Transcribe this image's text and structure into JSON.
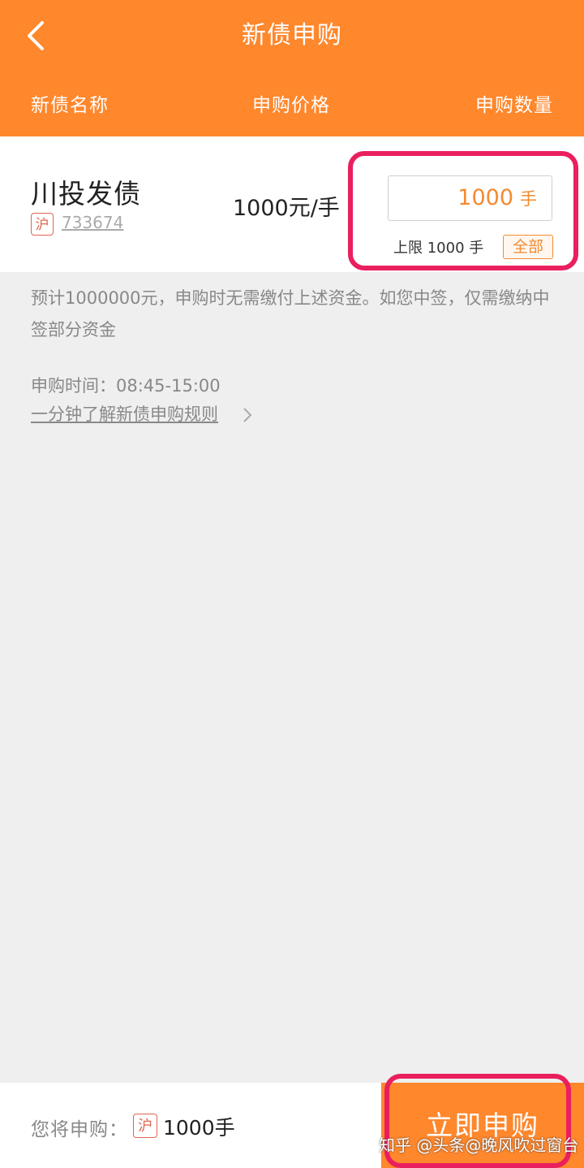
{
  "header": {
    "title": "新债申购",
    "columns": [
      "新债名称",
      "申购价格",
      "申购数量"
    ],
    "accent_color": "#ff872c"
  },
  "bond": {
    "name": "川投发债",
    "market_badge": "沪",
    "code": "733674",
    "price": "1000元/手",
    "quantity_value": "1000",
    "quantity_unit": "手",
    "limit_text": "上限 1000 手",
    "all_label": "全部"
  },
  "info": {
    "estimate_text": "预计1000000元，申购时无需缴付上述资金。如您中签，仅需缴纳中签部分资金",
    "time_text": "申购时间：08:45-15:00",
    "rules_link": "一分钟了解新债申购规则"
  },
  "bottom": {
    "label": "您将申购：",
    "market_badge": "沪",
    "quantity": "1000手",
    "submit_label": "立即申购"
  },
  "watermark": "知乎 @头条@晚风吹过窗台",
  "icons": {
    "back": "back-arrow-icon",
    "chevron": "chevron-right-icon"
  },
  "highlight_color": "#ea1f5e"
}
